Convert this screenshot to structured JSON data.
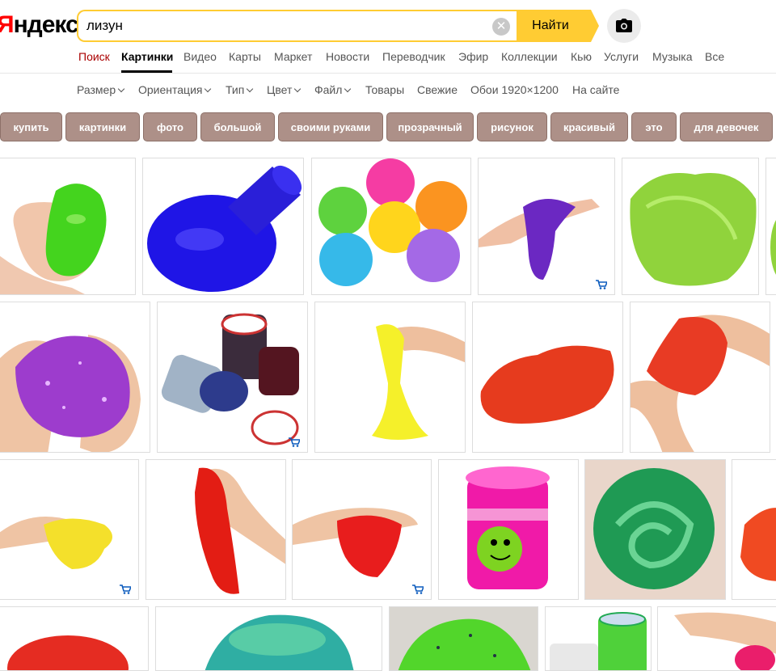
{
  "header": {
    "logo_red": "Я",
    "logo_black": "ндекс",
    "search_value": "лизун",
    "search_button": "Найти",
    "clear_icon": "close-icon",
    "camera_icon": "camera-icon"
  },
  "nav": {
    "items": [
      "Поиск",
      "Картинки",
      "Видео",
      "Карты",
      "Маркет",
      "Новости",
      "Переводчик",
      "Эфир",
      "Коллекции",
      "Кью",
      "Услуги",
      "Музыка",
      "Все"
    ],
    "active": "Картинки"
  },
  "filters": {
    "items": [
      "Размер",
      "Ориентация",
      "Тип",
      "Цвет",
      "Файл",
      "Товары",
      "Свежие",
      "Обои 1920×1200",
      "На сайте"
    ]
  },
  "chips": {
    "items": [
      "купить",
      "картинки",
      "фото",
      "большой",
      "своими руками",
      "прозрачный",
      "рисунок",
      "красивый",
      "это",
      "для девочек"
    ]
  },
  "colors": {
    "accent": "#ffcc33",
    "chip": "#ad9088"
  },
  "results": {
    "rows": [
      [
        {
          "subject": "green slime in hand"
        },
        {
          "subject": "blue slime barrel"
        },
        {
          "subject": "colored slime jars"
        },
        {
          "subject": "purple slime in hand",
          "cart": true
        },
        {
          "subject": "light green slime"
        },
        {
          "subject": "green slime partial"
        }
      ],
      [
        {
          "subject": "glitter purple slime in hands"
        },
        {
          "subject": "slime containers",
          "cart": true
        },
        {
          "subject": "yellow slime dripping"
        },
        {
          "subject": "red slime"
        },
        {
          "subject": "red slime stretched"
        }
      ],
      [
        {
          "subject": "yellow slime in hand",
          "cart": true
        },
        {
          "subject": "red slime hanging"
        },
        {
          "subject": "red slime in hand",
          "cart": true
        },
        {
          "subject": "pink slime jar"
        },
        {
          "subject": "green metallic slime"
        },
        {
          "subject": "orange slime partial"
        }
      ],
      [
        {
          "subject": "red slime"
        },
        {
          "subject": "blue green slime"
        },
        {
          "subject": "green slime with seeds"
        },
        {
          "subject": "green slime jar"
        },
        {
          "subject": "pink slime partial"
        }
      ]
    ]
  }
}
